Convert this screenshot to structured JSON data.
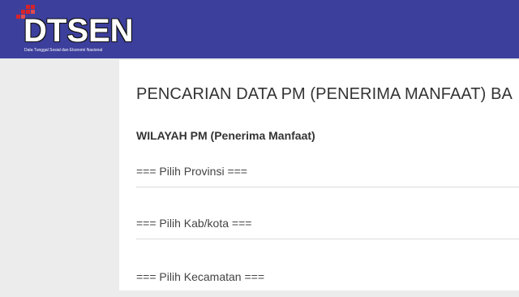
{
  "header": {
    "logo_text": "DTSEN",
    "logo_tagline": "Data Tunggal Sosial dan Ekonomi Nasional",
    "background_color": "#3c3f9c",
    "logo_accent_color": "#d8232a"
  },
  "main": {
    "title": "PENCARIAN DATA PM (PENERIMA MANFAAT) BA",
    "section_heading": "WILAYAH PM (Penerima Manfaat)",
    "selects": {
      "provinsi": "=== Pilih Provinsi ===",
      "kabkota": "=== Pilih Kab/kota ===",
      "kecamatan": "=== Pilih Kecamatan ==="
    }
  }
}
